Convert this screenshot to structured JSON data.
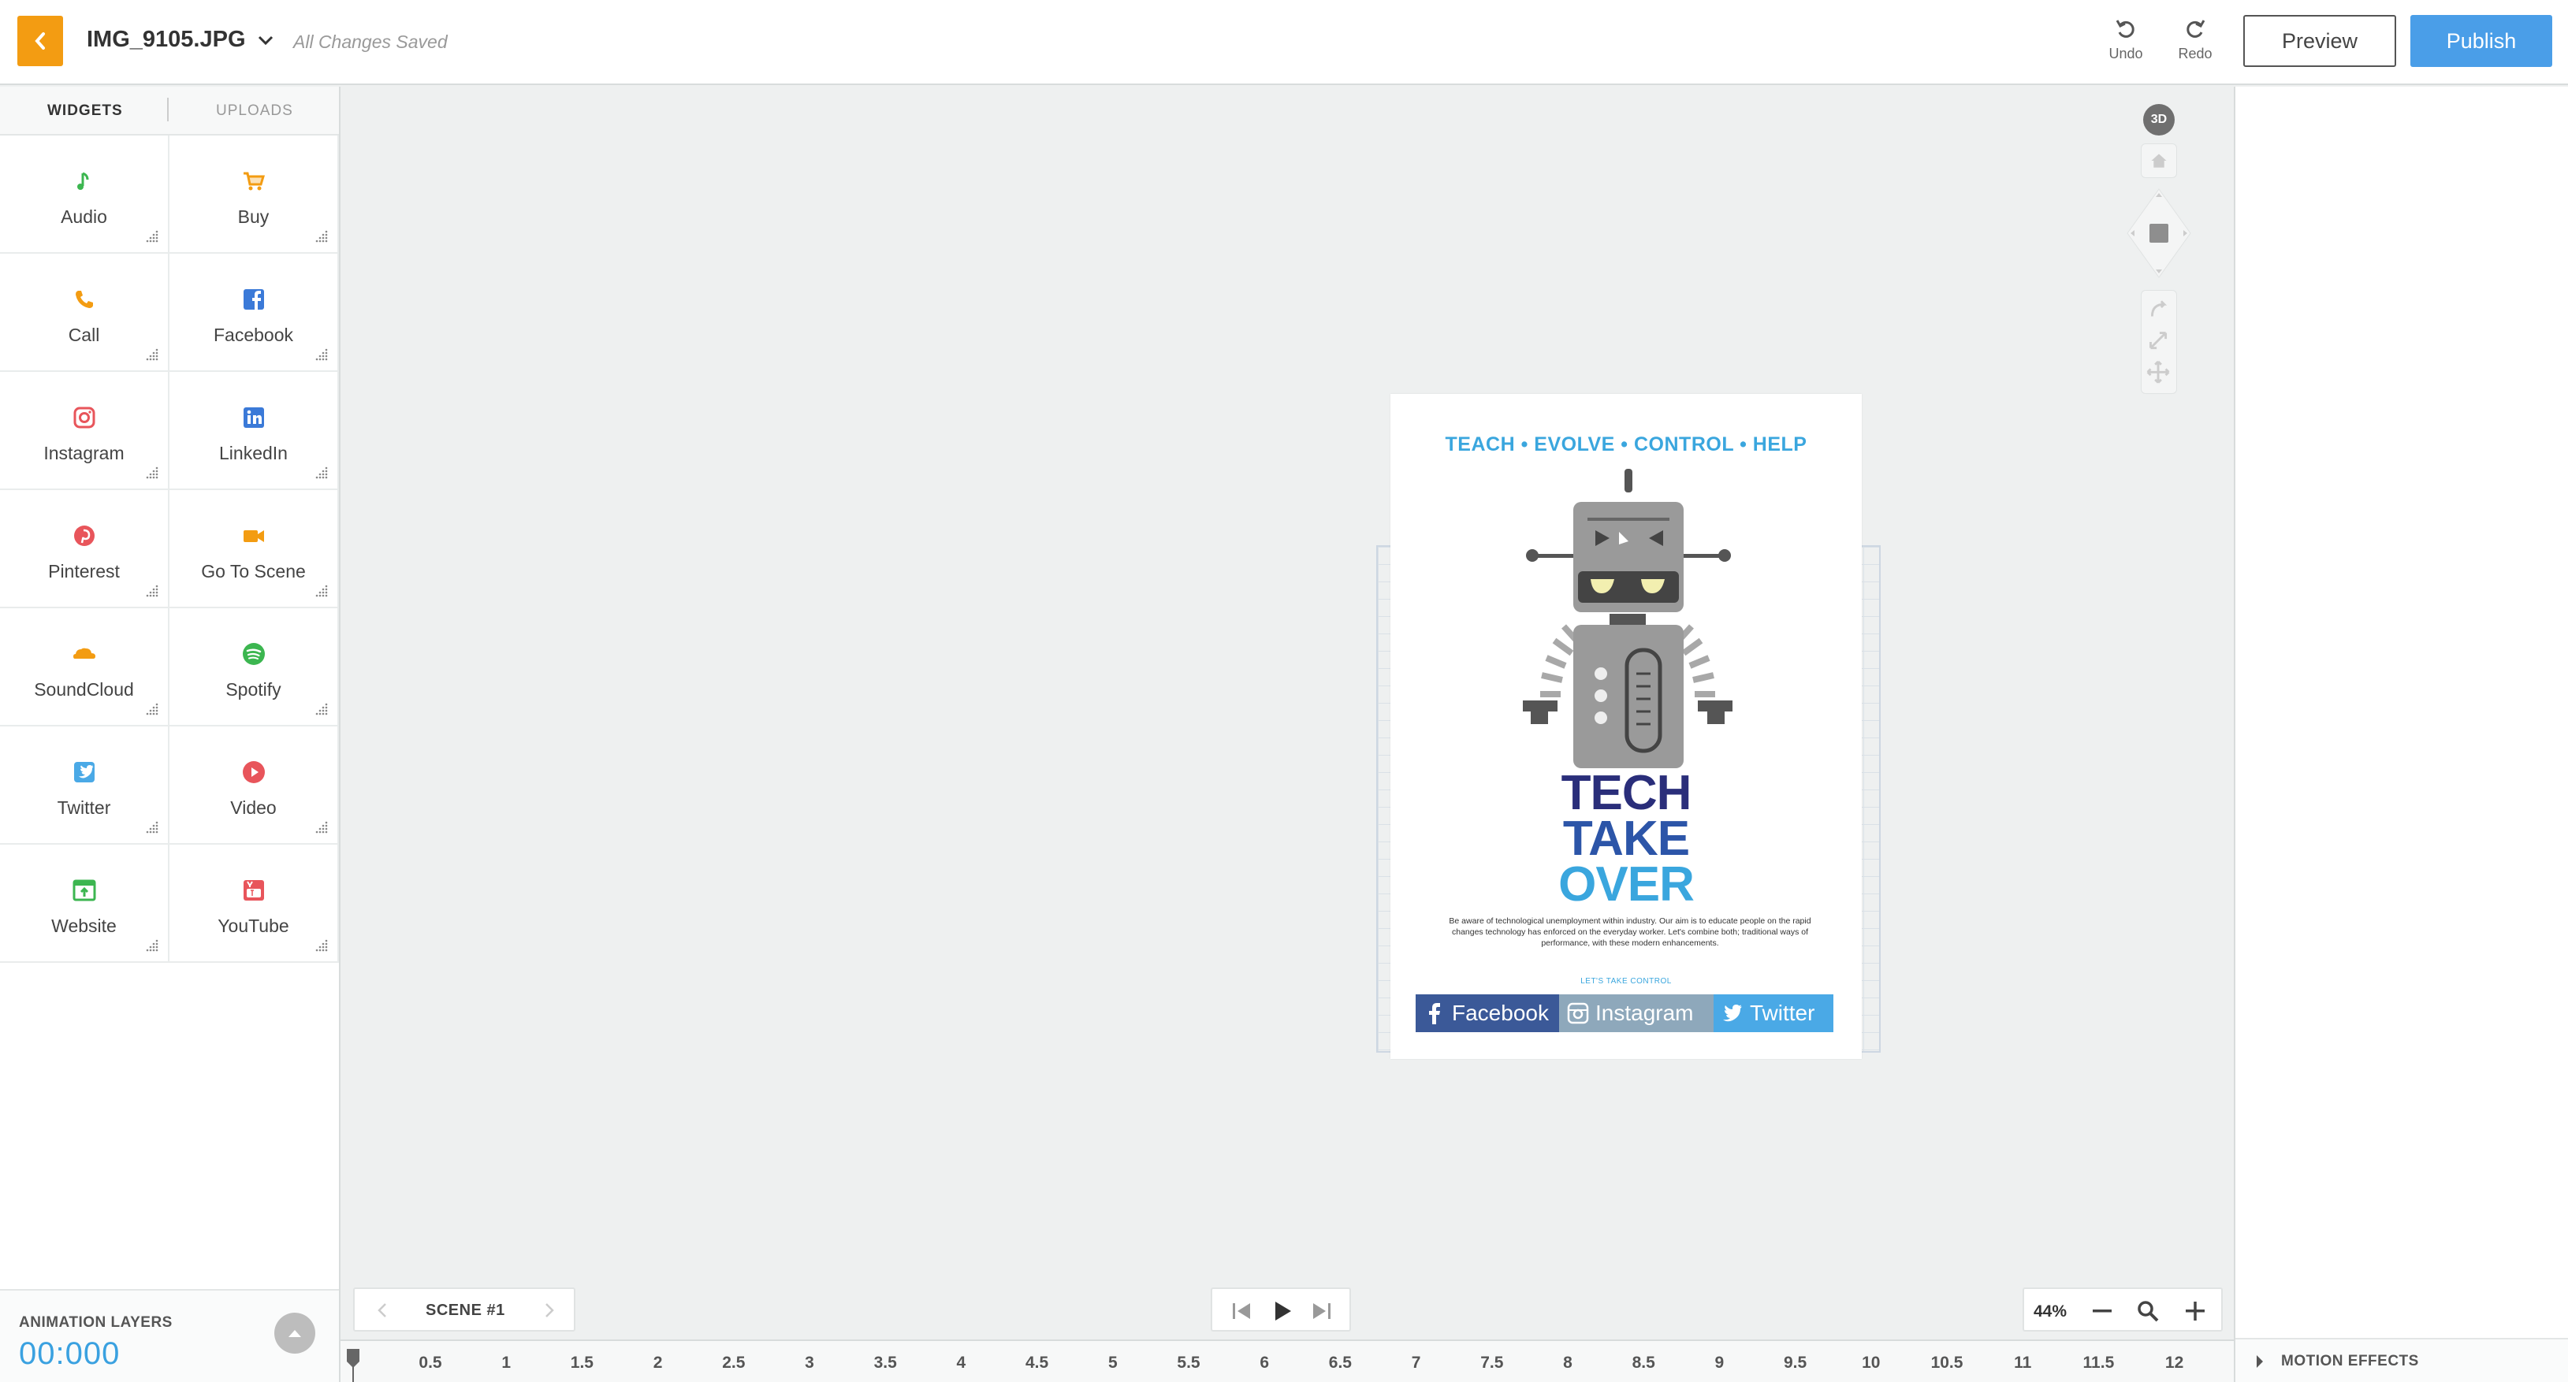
{
  "header": {
    "filename": "IMG_9105.JPG",
    "save_status": "All Changes Saved",
    "undo_label": "Undo",
    "redo_label": "Redo",
    "preview_label": "Preview",
    "publish_label": "Publish"
  },
  "left_panel": {
    "tabs": [
      {
        "label": "WIDGETS",
        "active": true
      },
      {
        "label": "UPLOADS",
        "active": false
      }
    ],
    "widgets": [
      {
        "label": "Audio",
        "icon": "music-note-icon",
        "color": "#3cb650"
      },
      {
        "label": "Buy",
        "icon": "shopping-cart-icon",
        "color": "#f39c12"
      },
      {
        "label": "Call",
        "icon": "phone-icon",
        "color": "#f39c12"
      },
      {
        "label": "Facebook",
        "icon": "facebook-icon",
        "color": "#3b7ad8"
      },
      {
        "label": "Instagram",
        "icon": "instagram-icon",
        "color": "#e8555b"
      },
      {
        "label": "LinkedIn",
        "icon": "linkedin-icon",
        "color": "#3b7ad8"
      },
      {
        "label": "Pinterest",
        "icon": "pinterest-icon",
        "color": "#e8555b"
      },
      {
        "label": "Go To Scene",
        "icon": "video-camera-icon",
        "color": "#f39c12"
      },
      {
        "label": "SoundCloud",
        "icon": "soundcloud-icon",
        "color": "#f39c12"
      },
      {
        "label": "Spotify",
        "icon": "spotify-icon",
        "color": "#3cb650"
      },
      {
        "label": "Twitter",
        "icon": "twitter-icon",
        "color": "#4aa9e6"
      },
      {
        "label": "Video",
        "icon": "play-circle-icon",
        "color": "#e8555b"
      },
      {
        "label": "Website",
        "icon": "website-icon",
        "color": "#3cb650"
      },
      {
        "label": "YouTube",
        "icon": "youtube-icon",
        "color": "#e8555b"
      }
    ],
    "animation_layers": {
      "title": "ANIMATION LAYERS",
      "time": "00:000"
    }
  },
  "canvas": {
    "nav_badge": "3D",
    "poster": {
      "subtitle": "TEACH • EVOLVE • CONTROL • HELP",
      "title_line1": "TECH",
      "title_line2": "TAKE",
      "title_line3": "OVER",
      "blurb": "Be aware of technological unemployment within industry. Our aim is to educate people on the rapid changes technology has enforced on the everyday worker. Let's combine both; traditional ways of performance, with these modern enhancements.",
      "cta": "LET'S TAKE CONTROL",
      "social": [
        {
          "label": "Facebook",
          "icon": "facebook-icon",
          "color": "#3b5998"
        },
        {
          "label": "Instagram",
          "icon": "instagram-icon",
          "color": "#8ea8bb"
        },
        {
          "label": "Twitter",
          "icon": "twitter-icon",
          "color": "#4aa9e6"
        }
      ]
    },
    "scene_label": "SCENE #1",
    "zoom_level": "44%"
  },
  "timeline": {
    "ticks": [
      "0.5",
      "1",
      "1.5",
      "2",
      "2.5",
      "3",
      "3.5",
      "4",
      "4.5",
      "5",
      "5.5",
      "6",
      "6.5",
      "7",
      "7.5",
      "8",
      "8.5",
      "9",
      "9.5",
      "10",
      "10.5",
      "11",
      "11.5",
      "12"
    ]
  },
  "right_panel": {
    "motion_effects_label": "MOTION EFFECTS"
  },
  "colors": {
    "accent_orange": "#f39c12",
    "publish_blue": "#4a9ee8",
    "time_blue": "#3aa1e0"
  }
}
